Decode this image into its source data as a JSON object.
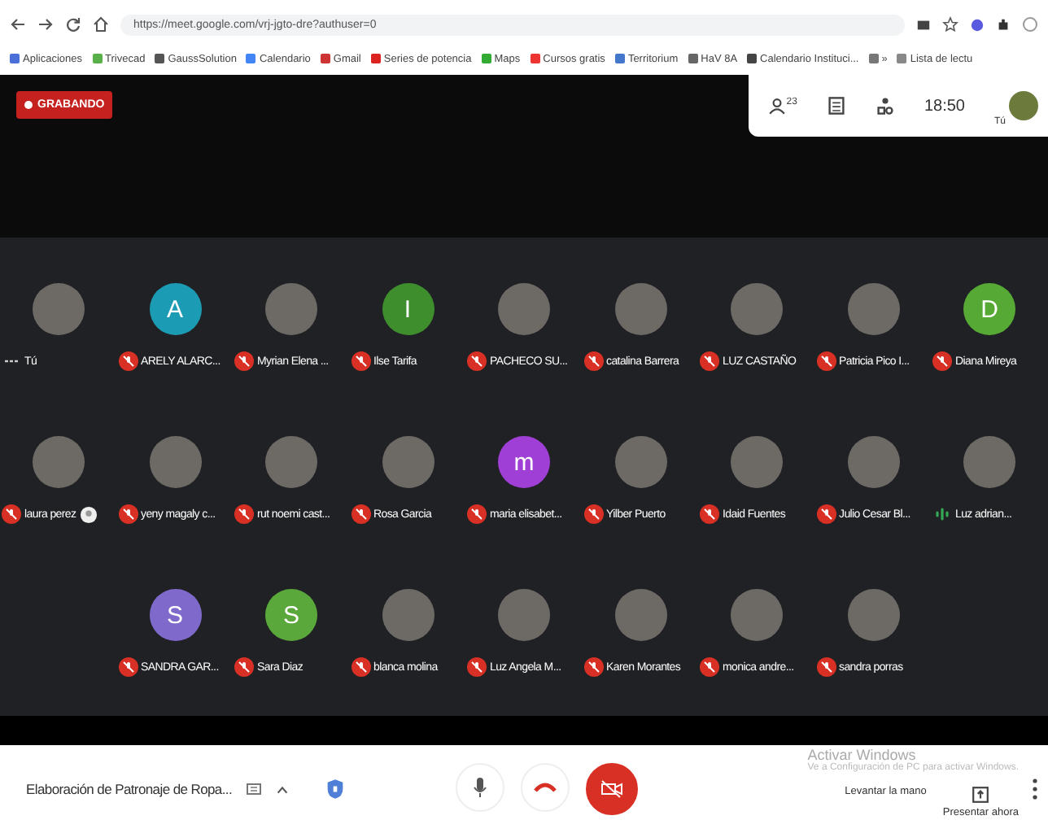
{
  "browser": {
    "url": "https://meet.google.com/vrj-jgto-dre?authuser=0",
    "bookmarks": [
      "Aplicaciones",
      "Trivecad",
      "GaussSolution",
      "Calendario",
      "Gmail",
      "Series de potencia",
      "Maps",
      "Cursos gratis",
      "Territorium",
      "HaV 8A",
      "Calendario Instituci...",
      "»",
      "Lista de lectu"
    ]
  },
  "recording": {
    "label": "GRABANDO"
  },
  "top_panel": {
    "participant_count": "23",
    "time": "18:50",
    "self_label": "Tú"
  },
  "participant_rows": [
    [
      {
        "name": "Tú",
        "avatar": {
          "kind": "photo"
        },
        "mic": {
          "kind": "menu"
        },
        "has_badge": false
      },
      {
        "name": "ARELY ALARC...",
        "avatar": {
          "kind": "letter",
          "letter": "A",
          "color": "#1b9bb4"
        },
        "mic": {
          "kind": "muted"
        },
        "has_badge": false
      },
      {
        "name": "Myrian Elena ...",
        "avatar": {
          "kind": "photo"
        },
        "mic": {
          "kind": "muted"
        },
        "has_badge": false
      },
      {
        "name": "Ilse Tarifa",
        "avatar": {
          "kind": "letter",
          "letter": "I",
          "color": "#3f8e2e"
        },
        "mic": {
          "kind": "muted"
        },
        "has_badge": false
      },
      {
        "name": "PACHECO SU...",
        "avatar": {
          "kind": "photo"
        },
        "mic": {
          "kind": "muted"
        },
        "has_badge": false
      },
      {
        "name": "catalina Barrera",
        "avatar": {
          "kind": "photo"
        },
        "mic": {
          "kind": "muted"
        },
        "has_badge": false
      },
      {
        "name": "LUZ CASTAÑO",
        "avatar": {
          "kind": "photo"
        },
        "mic": {
          "kind": "muted"
        },
        "has_badge": false
      },
      {
        "name": "Patricia Pico I...",
        "avatar": {
          "kind": "photo"
        },
        "mic": {
          "kind": "muted"
        },
        "has_badge": false
      },
      {
        "name": "Diana Mireya",
        "avatar": {
          "kind": "letter",
          "letter": "D",
          "color": "#56a934"
        },
        "mic": {
          "kind": "muted"
        },
        "has_badge": false
      }
    ],
    [
      {
        "name": "laura perez",
        "avatar": {
          "kind": "photo"
        },
        "mic": {
          "kind": "muted"
        },
        "has_badge": true
      },
      {
        "name": "yeny magaly c...",
        "avatar": {
          "kind": "photo"
        },
        "mic": {
          "kind": "muted"
        },
        "has_badge": false
      },
      {
        "name": "rut noemi cast...",
        "avatar": {
          "kind": "photo"
        },
        "mic": {
          "kind": "muted"
        },
        "has_badge": false
      },
      {
        "name": "Rosa Garcia",
        "avatar": {
          "kind": "photo"
        },
        "mic": {
          "kind": "muted"
        },
        "has_badge": false
      },
      {
        "name": "maria elisabet...",
        "avatar": {
          "kind": "letter",
          "letter": "m",
          "color": "#a03fd6"
        },
        "mic": {
          "kind": "muted"
        },
        "has_badge": false
      },
      {
        "name": "Yilber Puerto",
        "avatar": {
          "kind": "photo"
        },
        "mic": {
          "kind": "muted"
        },
        "has_badge": false
      },
      {
        "name": "Idaid Fuentes",
        "avatar": {
          "kind": "photo"
        },
        "mic": {
          "kind": "muted"
        },
        "has_badge": false
      },
      {
        "name": "Julio Cesar Bl...",
        "avatar": {
          "kind": "photo"
        },
        "mic": {
          "kind": "muted"
        },
        "has_badge": false
      },
      {
        "name": "Luz adrian...",
        "avatar": {
          "kind": "photo"
        },
        "mic": {
          "kind": "speaking"
        },
        "has_badge": false
      }
    ],
    [
      {
        "name": "SANDRA GAR...",
        "avatar": {
          "kind": "letter",
          "letter": "S",
          "color": "#7f6acb"
        },
        "mic": {
          "kind": "muted"
        },
        "has_badge": false
      },
      {
        "name": "Sara Diaz",
        "avatar": {
          "kind": "letter",
          "letter": "S",
          "color": "#5aa83b"
        },
        "mic": {
          "kind": "muted"
        },
        "has_badge": false
      },
      {
        "name": "blanca molina",
        "avatar": {
          "kind": "photo"
        },
        "mic": {
          "kind": "muted"
        },
        "has_badge": false
      },
      {
        "name": "Luz Angela M...",
        "avatar": {
          "kind": "photo"
        },
        "mic": {
          "kind": "muted"
        },
        "has_badge": false
      },
      {
        "name": "Karen Morantes",
        "avatar": {
          "kind": "photo"
        },
        "mic": {
          "kind": "muted"
        },
        "has_badge": false
      },
      {
        "name": "monica andre...",
        "avatar": {
          "kind": "photo"
        },
        "mic": {
          "kind": "muted"
        },
        "has_badge": false
      },
      {
        "name": "sandra porras",
        "avatar": {
          "kind": "photo"
        },
        "mic": {
          "kind": "muted"
        },
        "has_badge": false
      }
    ]
  ],
  "bottom_bar": {
    "meeting_title": "Elaboración de Patronaje de Ropa...",
    "raise_hand": "Levantar la mano",
    "present": "Presentar ahora"
  },
  "activation_notice": {
    "title": "Activar Windows",
    "text": "Ve a Configuración de PC para activar Windows."
  }
}
